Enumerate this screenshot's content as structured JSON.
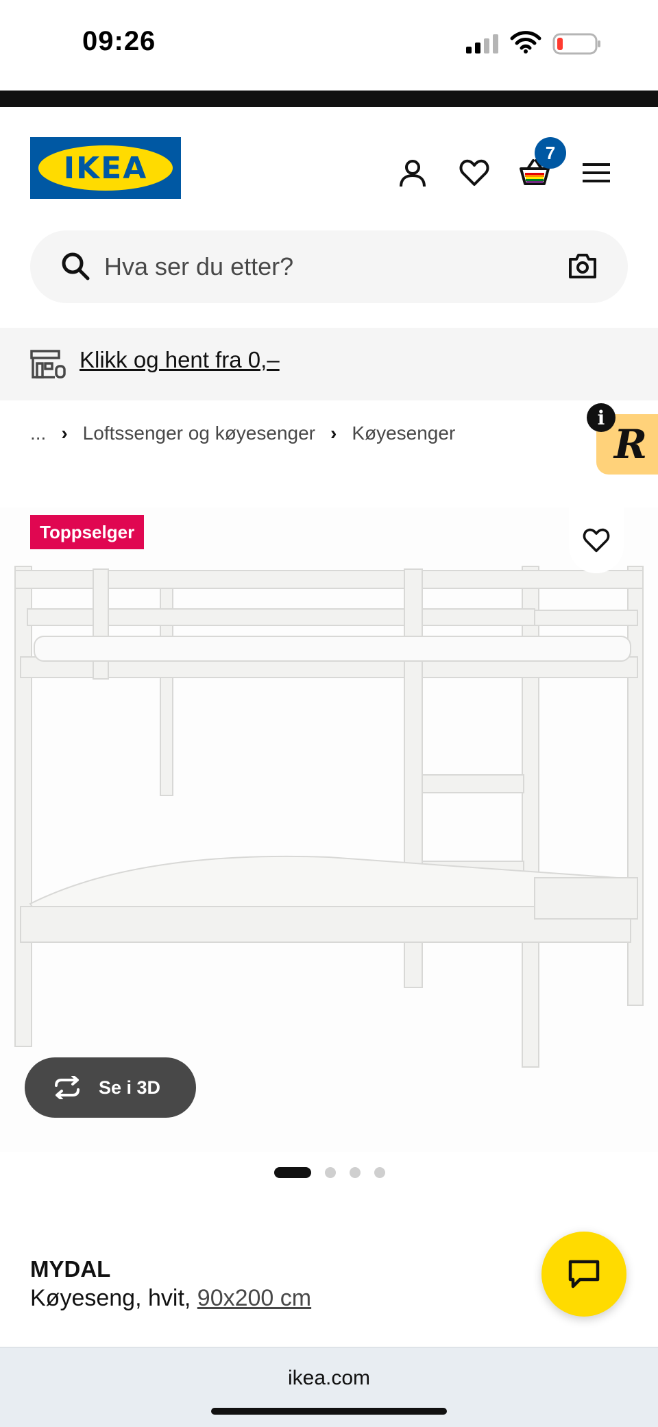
{
  "status_bar": {
    "time": "09:26"
  },
  "header": {
    "logo_text": "IKEA",
    "cart_count": "7"
  },
  "search": {
    "placeholder": "Hva ser du etter?"
  },
  "promo": {
    "link_text": "Klikk og hent fra 0,–"
  },
  "breadcrumb": {
    "ellipsis": "...",
    "items": [
      "Loftssenger og køyesenger",
      "Køyesenger"
    ]
  },
  "widget": {
    "letter": "R",
    "info": "i"
  },
  "product": {
    "badge": "Toppselger",
    "view3d_label": "Se i 3D",
    "gallery_total": 4,
    "gallery_active": 1,
    "name": "MYDAL",
    "description": "Køyeseng, hvit,",
    "size_link": "90x200 cm"
  },
  "browser": {
    "url": "ikea.com"
  },
  "colors": {
    "ikea_blue": "#0058a3",
    "ikea_yellow": "#ffdb00",
    "badge_red": "#e00751"
  }
}
